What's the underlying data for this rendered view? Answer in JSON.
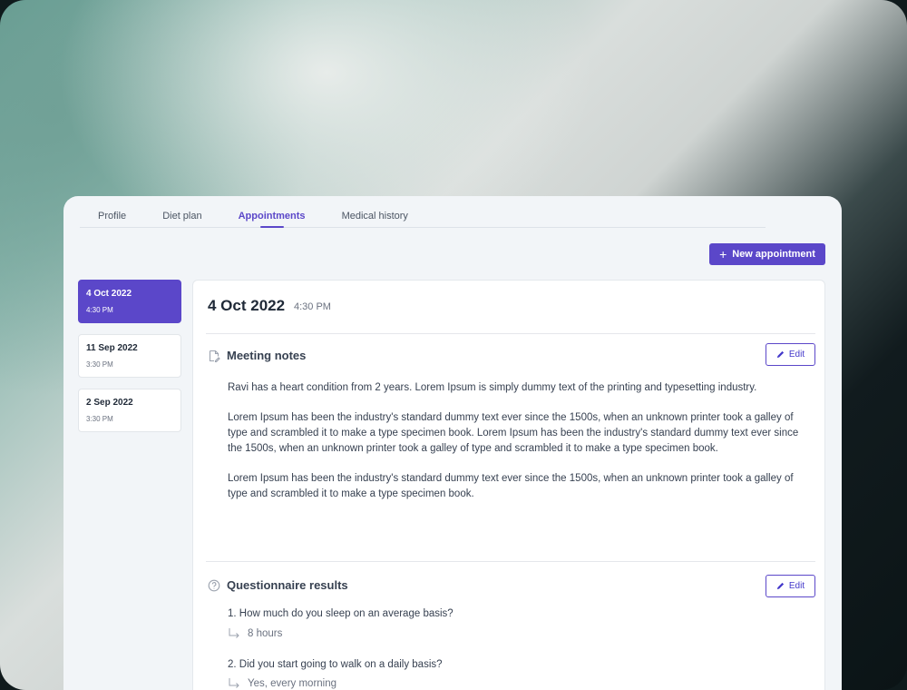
{
  "tabs": [
    {
      "label": "Profile"
    },
    {
      "label": "Diet plan"
    },
    {
      "label": "Appointments"
    },
    {
      "label": "Medical history"
    }
  ],
  "active_tab": "Appointments",
  "toolbar": {
    "new_appointment_label": "New appointment"
  },
  "appointments": [
    {
      "date": "4 Oct 2022",
      "time": "4:30 PM",
      "selected": true
    },
    {
      "date": "11 Sep 2022",
      "time": "3:30 PM",
      "selected": false
    },
    {
      "date": "2 Sep 2022",
      "time": "3:30 PM",
      "selected": false
    }
  ],
  "detail": {
    "date": "4 Oct 2022",
    "time": "4:30 PM",
    "meeting_notes": {
      "title": "Meeting notes",
      "edit_label": "Edit",
      "paragraphs": [
        "Ravi has a heart condition from 2 years. Lorem Ipsum is simply dummy text of the printing and typesetting industry.",
        "Lorem Ipsum has been the industry's standard dummy text ever since the 1500s, when an unknown printer took a galley of type and scrambled it to make a type specimen book. Lorem Ipsum has been the industry's standard dummy text ever since the 1500s, when an unknown printer took a galley of type and scrambled it to make a type specimen book.",
        "Lorem Ipsum has been the industry's standard dummy text ever since the 1500s, when an unknown printer took a galley of type and scrambled it to make a type specimen book."
      ]
    },
    "questionnaire": {
      "title": "Questionnaire results",
      "edit_label": "Edit",
      "items": [
        {
          "question": "1.  How much do you sleep on an average basis?",
          "answer": "8 hours"
        },
        {
          "question": "2. Did you start going to walk on a daily basis?",
          "answer": "Yes, every morning"
        }
      ]
    }
  },
  "colors": {
    "accent": "#5b47c9"
  }
}
